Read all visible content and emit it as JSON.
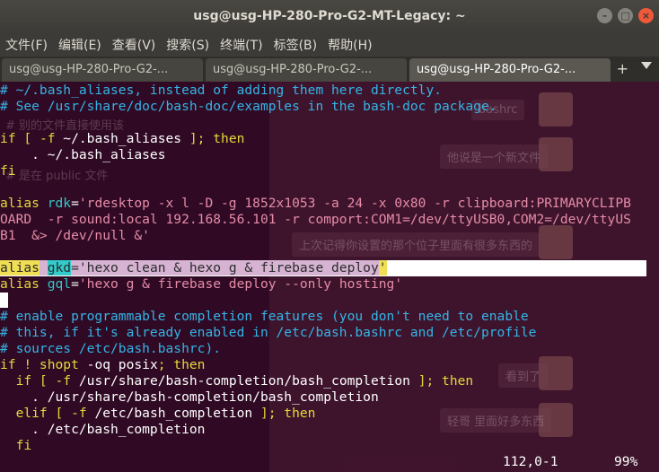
{
  "window": {
    "title": "usg@usg-HP-280-Pro-G2-MT-Legacy: ~",
    "minimize": "–",
    "maximize": "□",
    "close": "×"
  },
  "menu": [
    "文件(F)",
    "编辑(E)",
    "查看(V)",
    "搜索(S)",
    "终端(T)",
    "标签(B)",
    "帮助(H)"
  ],
  "tabs": [
    {
      "label": "usg@usg-HP-280-Pro-G2-...",
      "active": false
    },
    {
      "label": "usg@usg-HP-280-Pro-G2-...",
      "active": false
    },
    {
      "label": "usg@usg-HP-280-Pro-G2-...",
      "active": true
    }
  ],
  "tab_add": "+",
  "ghost": {
    "bubbles": [
      "bashrc",
      "他说是一个新文件",
      "上次记得你设置的那个位子里面有很多东西的",
      "看到了",
      "轻哥 里面好多东西"
    ],
    "left_texts": [
      "# 别的文件直接使用该",
      "# 是在 public 文件"
    ]
  },
  "terminal_lines": [
    {
      "segments": [
        {
          "t": "# ~/.bash_aliases, instead of adding them here directly.",
          "c": "c-comment"
        }
      ]
    },
    {
      "segments": [
        {
          "t": "# See /usr/share/doc/bash-doc/examples in the bash-doc package.",
          "c": "c-comment"
        }
      ]
    },
    {
      "segments": []
    },
    {
      "segments": [
        {
          "t": "if [ ",
          "c": "c-kw"
        },
        {
          "t": "-f",
          "c": "c-kw"
        },
        {
          "t": " ~/.bash_aliases ",
          "c": "c-white"
        },
        {
          "t": "]; then",
          "c": "c-kw"
        }
      ]
    },
    {
      "segments": [
        {
          "t": "    . ~/.bash_aliases",
          "c": "c-white"
        }
      ]
    },
    {
      "segments": [
        {
          "t": "fi",
          "c": "c-kw"
        }
      ]
    },
    {
      "segments": []
    },
    {
      "segments": [
        {
          "t": "alias ",
          "c": "c-alias"
        },
        {
          "t": "rdk",
          "c": "c-name"
        },
        {
          "t": "=",
          "c": "c-op"
        },
        {
          "t": "'rdesktop -x l -D -g 1852x1053 -a 24 -x 0x80 -r clipboard:PRIMARYCLIPB",
          "c": "c-str"
        }
      ]
    },
    {
      "segments": [
        {
          "t": "OARD  -r sound:local 192.168.56.101 -r comport:COM1=/dev/ttyUSB0,COM2=/dev/ttyUS",
          "c": "c-str"
        }
      ]
    },
    {
      "segments": [
        {
          "t": "B1  &> /dev/null &'",
          "c": "c-str"
        }
      ]
    },
    {
      "segments": []
    },
    {
      "highlight": true,
      "segments": [
        {
          "t": "alias",
          "c": "hl-alias"
        },
        {
          "t": " ",
          "c": "hl-str"
        },
        {
          "t": "gkd",
          "c": "hl-gkd"
        },
        {
          "t": "='hexo clean & hexo g & firebase deploy",
          "c": "hl-str"
        },
        {
          "t": "'",
          "c": "hl-quote"
        }
      ]
    },
    {
      "segments": [
        {
          "t": "alias ",
          "c": "c-alias"
        },
        {
          "t": "gql",
          "c": "c-name"
        },
        {
          "t": "=",
          "c": "c-op"
        },
        {
          "t": "'hexo g & firebase deploy --only hosting'",
          "c": "c-str"
        }
      ]
    },
    {
      "cursor": true,
      "segments": []
    },
    {
      "segments": [
        {
          "t": "# enable programmable completion features (you don't need to enable",
          "c": "c-comment"
        }
      ]
    },
    {
      "segments": [
        {
          "t": "# this, if it's already enabled in /etc/bash.bashrc and /etc/profile",
          "c": "c-comment"
        }
      ]
    },
    {
      "segments": [
        {
          "t": "# sources /etc/bash.bashrc).",
          "c": "c-comment"
        }
      ]
    },
    {
      "segments": [
        {
          "t": "if ! shopt ",
          "c": "c-kw"
        },
        {
          "t": "-oq posix",
          "c": "c-white"
        },
        {
          "t": "; then",
          "c": "c-kw"
        }
      ]
    },
    {
      "segments": [
        {
          "t": "  if [ ",
          "c": "c-kw"
        },
        {
          "t": "-f",
          "c": "c-kw"
        },
        {
          "t": " /usr/share/bash-completion/bash_completion ",
          "c": "c-white"
        },
        {
          "t": "]; then",
          "c": "c-kw"
        }
      ]
    },
    {
      "segments": [
        {
          "t": "    . /usr/share/bash-completion/bash_completion",
          "c": "c-white"
        }
      ]
    },
    {
      "segments": [
        {
          "t": "  elif [ ",
          "c": "c-kw"
        },
        {
          "t": "-f",
          "c": "c-kw"
        },
        {
          "t": " /etc/bash_completion ",
          "c": "c-white"
        },
        {
          "t": "]; then",
          "c": "c-kw"
        }
      ]
    },
    {
      "segments": [
        {
          "t": "    . /etc/bash_completion",
          "c": "c-white"
        }
      ]
    },
    {
      "segments": [
        {
          "t": "  fi",
          "c": "c-kw"
        }
      ]
    }
  ],
  "status": {
    "position": "112,0-1",
    "percent": "99%"
  }
}
